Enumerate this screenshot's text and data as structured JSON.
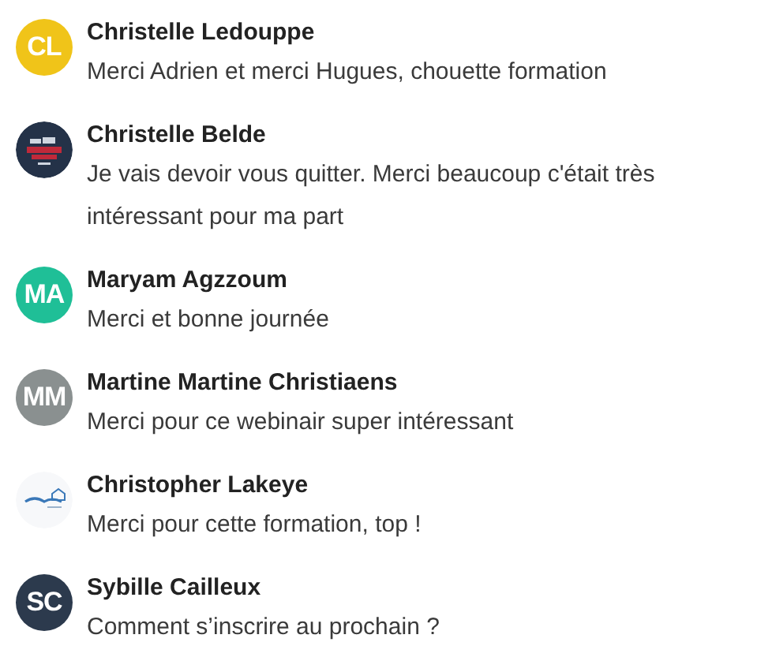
{
  "messages": [
    {
      "author": "Christelle Ledouppe",
      "text": "Merci Adrien et merci Hugues, chouette formation",
      "avatar": {
        "kind": "initials",
        "initials": "CL",
        "color": "#f0c419"
      }
    },
    {
      "author": "Christelle Belde",
      "text": "Je vais devoir vous quitter. Merci beaucoup c'était très intéressant pour ma part",
      "avatar": {
        "kind": "logo-dark"
      }
    },
    {
      "author": "Maryam Agzzoum",
      "text": "Merci et bonne journée",
      "avatar": {
        "kind": "initials",
        "initials": "MA",
        "color": "#1fbf97"
      }
    },
    {
      "author": "Martine Martine Christiaens",
      "text": "Merci pour ce webinair super intéressant",
      "avatar": {
        "kind": "initials",
        "initials": "MM",
        "color": "#8a9090"
      }
    },
    {
      "author": "Christopher Lakeye",
      "text": "Merci pour cette formation, top !",
      "avatar": {
        "kind": "logo-light"
      }
    },
    {
      "author": "Sybille Cailleux",
      "text": "Comment s’inscrire au prochain ?",
      "avatar": {
        "kind": "initials",
        "initials": "SC",
        "color": "#2c3a4d"
      }
    }
  ]
}
